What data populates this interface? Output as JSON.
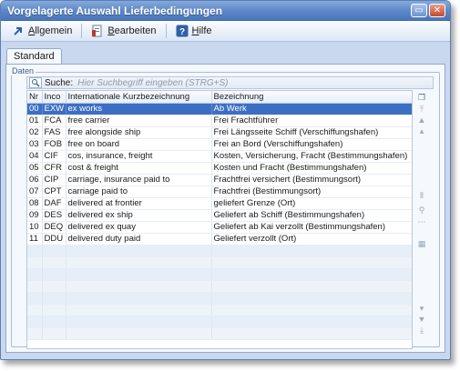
{
  "window": {
    "title": "Vorgelagerte Auswahl Lieferbedingungen"
  },
  "toolbar": {
    "items": [
      {
        "label": "Allgemein",
        "mnemonic": "A",
        "rest": "llgemein",
        "icon": "arrow-icon"
      },
      {
        "label": "Bearbeiten",
        "mnemonic": "B",
        "rest": "earbeiten",
        "icon": "edit-icon"
      },
      {
        "label": "Hilfe",
        "mnemonic": "H",
        "rest": "ilfe",
        "icon": "help-icon"
      }
    ]
  },
  "tabs": [
    {
      "label": "Standard"
    }
  ],
  "group": {
    "label": "Daten"
  },
  "search": {
    "label": "Suche:",
    "placeholder": "Hier Suchbegriff eingeben (STRG+S)"
  },
  "table": {
    "columns": [
      "Nr",
      "Inco",
      "Internationale Kurzbezeichnung",
      "Bezeichnung"
    ],
    "selected_index": 0,
    "rows": [
      {
        "nr": "00",
        "inco": "EXW",
        "kurz": "ex works",
        "bez": "Ab Werk"
      },
      {
        "nr": "01",
        "inco": "FCA",
        "kurz": "free carrier",
        "bez": "Frei Frachtführer"
      },
      {
        "nr": "02",
        "inco": "FAS",
        "kurz": "free alongside ship",
        "bez": "Frei Längsseite Schiff (Verschiffungshafen)"
      },
      {
        "nr": "03",
        "inco": "FOB",
        "kurz": "free on board",
        "bez": "Frei an Bord (Verschiffungshafen)"
      },
      {
        "nr": "04",
        "inco": "CIF",
        "kurz": "cos, insurance, freight",
        "bez": "Kosten, Versicherung, Fracht (Bestimmungshafen)"
      },
      {
        "nr": "05",
        "inco": "CFR",
        "kurz": "cost & freight",
        "bez": "Kosten und Fracht (Bestimmungshafen)"
      },
      {
        "nr": "06",
        "inco": "CIP",
        "kurz": "carriage, insurance paid to",
        "bez": "Frachtfrei versichert (Bestimmungsort)"
      },
      {
        "nr": "07",
        "inco": "CPT",
        "kurz": "carriage paid to",
        "bez": "Frachtfrei (Bestimmungsort)"
      },
      {
        "nr": "08",
        "inco": "DAF",
        "kurz": "delivered at frontier",
        "bez": "geliefert Grenze (Ort)"
      },
      {
        "nr": "09",
        "inco": "DES",
        "kurz": "delivered ex ship",
        "bez": "Geliefert ab Schiff (Bestimmungshafen)"
      },
      {
        "nr": "10",
        "inco": "DEQ",
        "kurz": "delivered ex quay",
        "bez": "Geliefert ab Kai verzollt (Bestimmungshafen)"
      },
      {
        "nr": "11",
        "inco": "DDU",
        "kurz": "delivered duty paid",
        "bez": "Geliefert verzollt (Ort)"
      }
    ]
  },
  "colors": {
    "title_bar": "#5b86c7",
    "selection": "#3c6fc4",
    "window_bg": "#c9d8ee"
  }
}
